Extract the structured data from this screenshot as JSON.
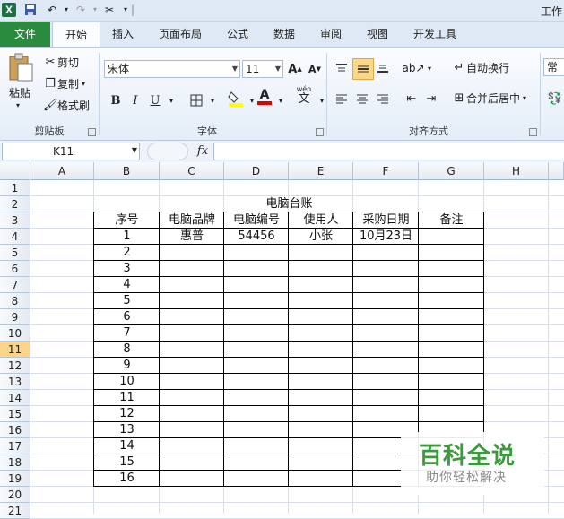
{
  "app": {
    "window_title": "工作"
  },
  "tabs": [
    {
      "label": "文件"
    },
    {
      "label": "开始"
    },
    {
      "label": "插入"
    },
    {
      "label": "页面布局"
    },
    {
      "label": "公式"
    },
    {
      "label": "数据"
    },
    {
      "label": "审阅"
    },
    {
      "label": "视图"
    },
    {
      "label": "开发工具"
    }
  ],
  "ribbon": {
    "clipboard": {
      "paste": "粘贴",
      "cut": "剪切",
      "copy": "复制",
      "format_painter": "格式刷",
      "group": "剪贴板"
    },
    "font": {
      "name": "宋体",
      "size": "11",
      "group": "字体",
      "bold": "B",
      "italic": "I",
      "underline": "U",
      "grow": "A",
      "shrink": "A",
      "wen": "wén",
      "wen_char": "文",
      "font_color_letter": "A"
    },
    "alignment": {
      "wrap": "自动换行",
      "merge": "合并后居中",
      "group": "对齐方式"
    },
    "number": {
      "format": "常规"
    }
  },
  "formula_bar": {
    "name_box": "K11",
    "fx": "fx",
    "formula": ""
  },
  "sheet": {
    "columns": [
      "A",
      "B",
      "C",
      "D",
      "E",
      "F",
      "G",
      "H"
    ],
    "rows": [
      "1",
      "2",
      "3",
      "4",
      "5",
      "6",
      "7",
      "8",
      "9",
      "10",
      "11",
      "12",
      "13",
      "14",
      "15",
      "16",
      "17",
      "18",
      "19",
      "20",
      "21"
    ],
    "active_row": "11",
    "title": "电脑台账",
    "headers": [
      "序号",
      "电脑品牌",
      "电脑编号",
      "使用人",
      "采购日期",
      "备注"
    ],
    "first_record": [
      "1",
      "惠普",
      "54456",
      "小张",
      "10月23日",
      ""
    ],
    "serials": [
      "2",
      "3",
      "4",
      "5",
      "6",
      "7",
      "8",
      "9",
      "10",
      "11",
      "12",
      "13",
      "14",
      "15",
      "16"
    ]
  },
  "watermark": {
    "title": "百科全说",
    "subtitle": "助你轻松解决"
  },
  "colors": {
    "file_tab": "#2a8a3d",
    "active_row_header": "#f9d68a",
    "ribbon_bg": "#e4edf8",
    "watermark": "#3c9a3c"
  }
}
